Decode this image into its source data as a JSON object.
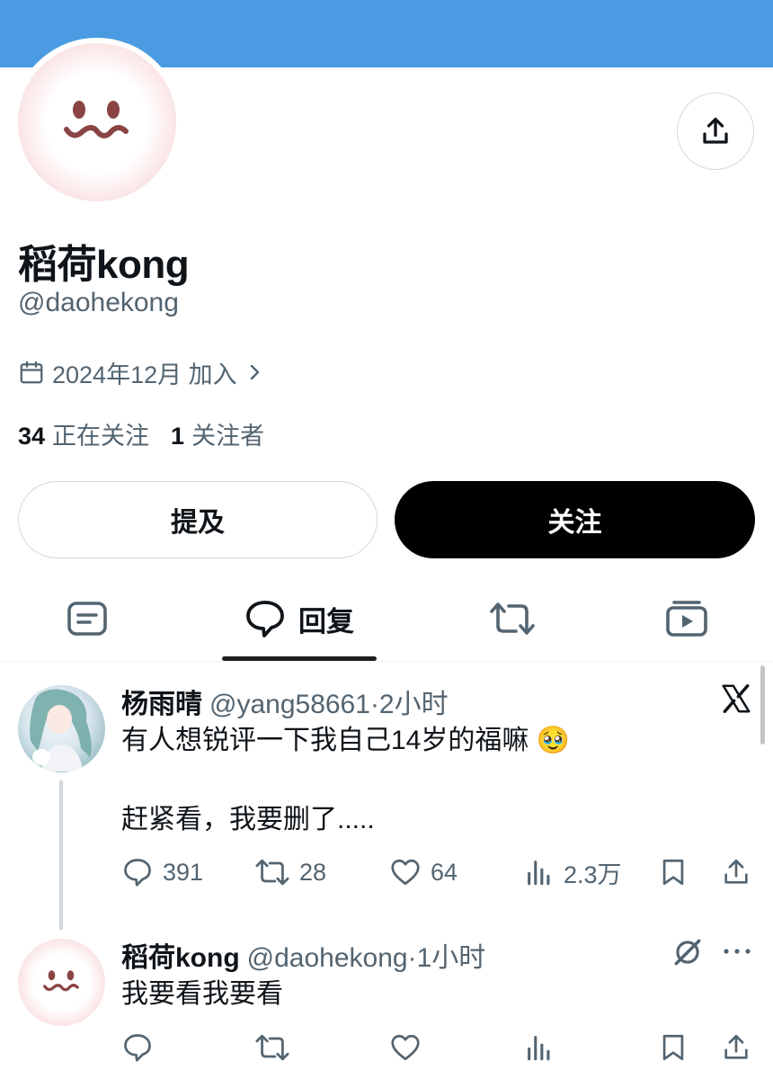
{
  "profile": {
    "display_name": "稻荷kong",
    "handle": "@daohekong",
    "joined": "2024年12月 加入",
    "following_count": "34",
    "following_label": "正在关注",
    "followers_count": "1",
    "followers_label": "关注者"
  },
  "buttons": {
    "mention": "提及",
    "follow": "关注"
  },
  "tabs": [
    {
      "name": "posts",
      "icon": "post-icon",
      "label": ""
    },
    {
      "name": "replies",
      "icon": "speech-bubble-icon",
      "label": "回复"
    },
    {
      "name": "reposts",
      "icon": "repost-icon",
      "label": ""
    },
    {
      "name": "media",
      "icon": "media-icon",
      "label": ""
    }
  ],
  "tweets": [
    {
      "name": "杨雨晴",
      "handle": "@yang58661",
      "time": "·2小时",
      "text_line1": "有人想锐评一下我自己14岁的福嘛 🥹",
      "text_line2": "赶紧看，我要删了.....",
      "replies": "391",
      "reposts": "28",
      "likes": "64",
      "views": "2.3万"
    },
    {
      "name": "稻荷kong",
      "handle": "@daohekong",
      "time": "·1小时",
      "text": "我要看我要看"
    }
  ],
  "colors": {
    "banner": "#4a9be2",
    "secondary_text": "#536471",
    "primary_text": "#0f1419"
  }
}
